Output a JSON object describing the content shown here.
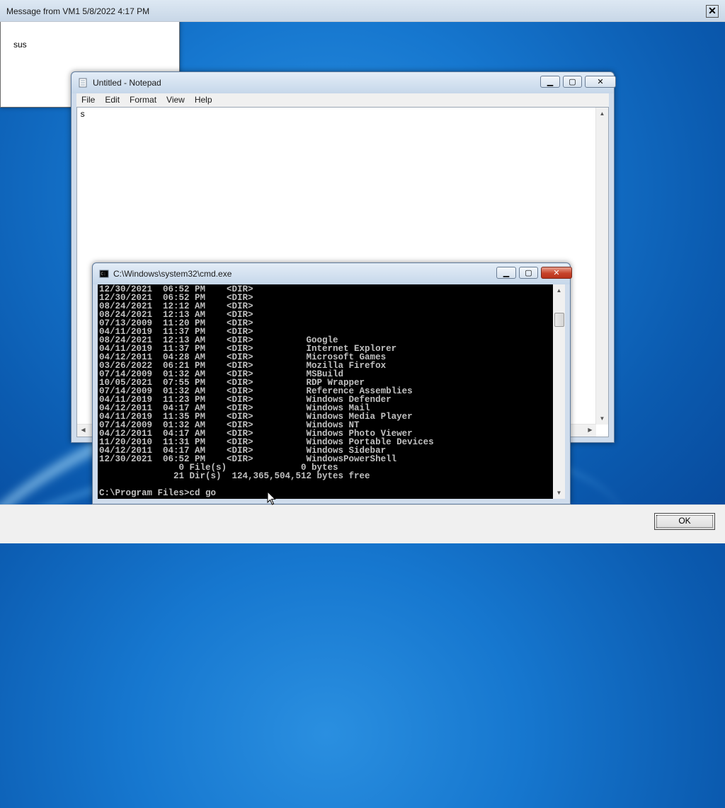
{
  "notepad": {
    "title": "Untitled - Notepad",
    "menu": [
      "File",
      "Edit",
      "Format",
      "View",
      "Help"
    ],
    "content": "s"
  },
  "cmd": {
    "title": "C:\\Windows\\system32\\cmd.exe",
    "lines": [
      "12/30/2021  06:52 PM    <DIR>",
      "12/30/2021  06:52 PM    <DIR>",
      "08/24/2021  12:12 AM    <DIR>",
      "08/24/2021  12:13 AM    <DIR>",
      "07/13/2009  11:20 PM    <DIR>",
      "04/11/2019  11:37 PM    <DIR>",
      "08/24/2021  12:13 AM    <DIR>          Google",
      "04/11/2019  11:37 PM    <DIR>          Internet Explorer",
      "04/12/2011  04:28 AM    <DIR>          Microsoft Games",
      "03/26/2022  06:21 PM    <DIR>          Mozilla Firefox",
      "07/14/2009  01:32 AM    <DIR>          MSBuild",
      "10/05/2021  07:55 PM    <DIR>          RDP Wrapper",
      "07/14/2009  01:32 AM    <DIR>          Reference Assemblies",
      "04/11/2019  11:23 PM    <DIR>          Windows Defender",
      "04/12/2011  04:17 AM    <DIR>          Windows Mail",
      "04/11/2019  11:35 PM    <DIR>          Windows Media Player",
      "07/14/2009  01:32 AM    <DIR>          Windows NT",
      "04/12/2011  04:17 AM    <DIR>          Windows Photo Viewer",
      "11/20/2010  11:31 PM    <DIR>          Windows Portable Devices",
      "04/12/2011  04:17 AM    <DIR>          Windows Sidebar",
      "12/30/2021  06:52 PM    <DIR>          WindowsPowerShell",
      "               0 File(s)              0 bytes",
      "              21 Dir(s)  124,365,504,512 bytes free",
      "",
      "C:\\Program Files>cd go"
    ]
  },
  "message": {
    "title": "Message from VM1 5/8/2022 4:17 PM",
    "text": "sus",
    "ok_label": "OK"
  },
  "icons": {
    "minimize": "minimize-icon",
    "maximize": "maximize-icon",
    "close": "close-icon"
  }
}
